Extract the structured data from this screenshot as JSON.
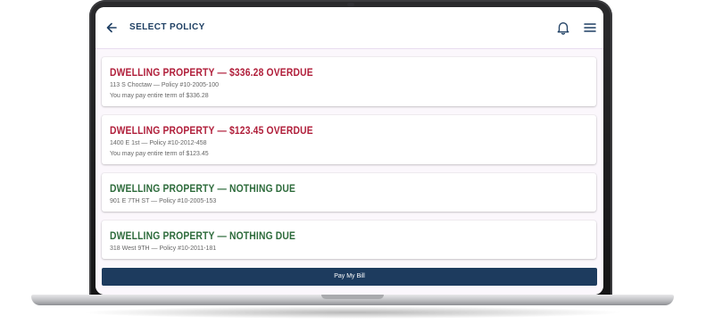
{
  "header": {
    "back_icon": "arrow-left-icon",
    "title": "SELECT POLICY",
    "bell_icon": "bell-icon",
    "menu_icon": "hamburger-menu-icon"
  },
  "colors": {
    "brand_navy": "#1d3b5e",
    "overdue_red": "#b01e3a",
    "ok_green": "#2d6b3b"
  },
  "policies": [
    {
      "title": "DWELLING PROPERTY — $336.28 OVERDUE",
      "status": "overdue",
      "address_line": "113 S Choctaw — Policy #10-2005-100",
      "pay_line": "You may pay entire term of $336.28"
    },
    {
      "title": "DWELLING PROPERTY — $123.45 OVERDUE",
      "status": "overdue",
      "address_line": "1400 E 1st — Policy #10-2012-458",
      "pay_line": "You may pay entire term of $123.45"
    },
    {
      "title": "DWELLING PROPERTY — NOTHING DUE",
      "status": "ok",
      "address_line": "901 E 7TH ST — Policy #10-2005-153"
    },
    {
      "title": "DWELLING PROPERTY — NOTHING DUE",
      "status": "ok",
      "address_line": "318 West 9TH — Policy #10-2011-181"
    }
  ],
  "footer": {
    "pay_button_label": "Pay My Bill"
  }
}
